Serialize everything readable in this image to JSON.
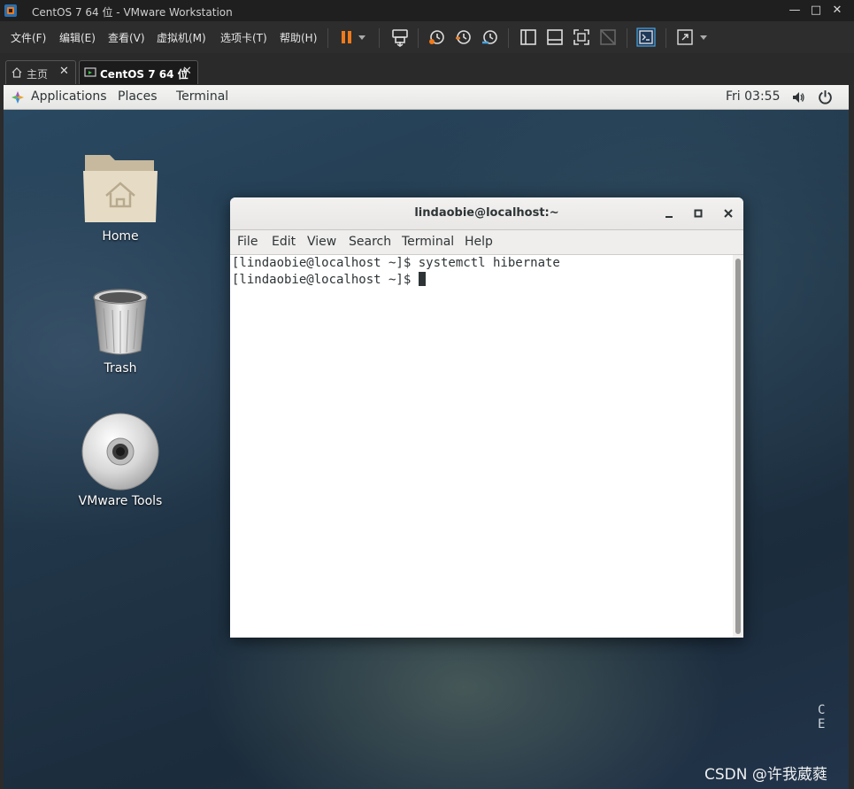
{
  "vmware": {
    "window_title": "CentOS 7 64 位 - VMware Workstation",
    "window_controls": {
      "minimize": "—",
      "maximize": "□",
      "close": "✕"
    },
    "menus": [
      "文件(F)",
      "编辑(E)",
      "查看(V)",
      "虚拟机(M)",
      "选项卡(T)",
      "帮助(H)"
    ],
    "toolbar_icons": [
      "pause-icon",
      "dropdown-arrow-icon",
      "send-ctrl-alt-del-icon",
      "snapshot-icon",
      "revert-snapshot-icon",
      "snapshot-manager-icon",
      "show-library-icon",
      "thumbnail-bar-icon",
      "full-screen-icon",
      "unity-icon",
      "console-view-icon",
      "stretch-view-icon",
      "dropdown-arrow-icon"
    ],
    "tabs": [
      {
        "label": "主页",
        "icon": "home-icon",
        "active": false
      },
      {
        "label": "CentOS 7 64 位",
        "icon": "vm-icon",
        "active": true
      }
    ]
  },
  "gnome": {
    "applications": "Applications",
    "places": "Places",
    "terminal": "Terminal",
    "clock": "Fri 03:55",
    "status_icons": [
      "volume-icon",
      "power-icon"
    ]
  },
  "desktop": {
    "icons": [
      {
        "label": "Home",
        "icon": "home-folder-icon"
      },
      {
        "label": "Trash",
        "icon": "trash-icon"
      },
      {
        "label": "VMware Tools",
        "icon": "cd-icon"
      }
    ],
    "corner_text": "C E"
  },
  "terminal": {
    "title": "lindaobie@localhost:~",
    "menu": [
      "File",
      "Edit",
      "View",
      "Search",
      "Terminal",
      "Help"
    ],
    "lines": [
      "[lindaobie@localhost ~]$ systemctl hibernate",
      "[lindaobie@localhost ~]$ "
    ]
  },
  "watermark": "CSDN @许我葳蕤",
  "colors": {
    "vmware_accent": "#f07a1a",
    "desktop_bg": "#22384b"
  }
}
